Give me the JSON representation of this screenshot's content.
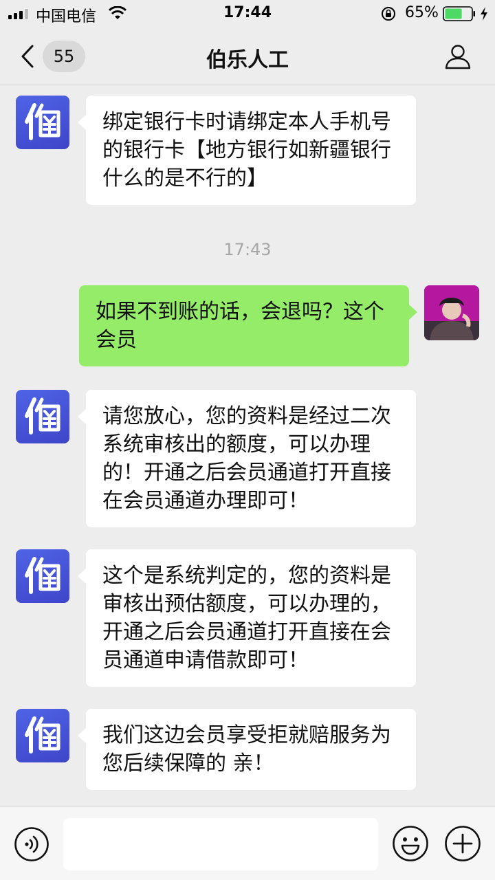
{
  "status_bar": {
    "carrier": "中国电信",
    "time": "17:44",
    "battery_percent": "65%",
    "battery_level": 0.65,
    "signal_icon": "signal-bars-icon",
    "wifi_icon": "wifi-icon",
    "lock_icon": "orientation-lock-icon",
    "charge_icon": "charging-bolt-icon"
  },
  "navbar": {
    "title": "伯乐人工",
    "unread_count": "55",
    "back_icon": "chevron-left-icon",
    "profile_icon": "person-icon"
  },
  "messages": [
    {
      "sender": "bot",
      "text": "绑定银行卡时请绑定本人手机号的银行卡【地方银行如新疆银行什么的是不行的】"
    },
    {
      "type": "timestamp",
      "text": "17:43"
    },
    {
      "sender": "me",
      "text": "如果不到账的话，会退吗？这个会员"
    },
    {
      "sender": "bot",
      "text": "请您放心，您的资料是经过二次系统审核出的额度，可以办理的！开通之后会员通道打开直接在会员通道办理即可！"
    },
    {
      "sender": "bot",
      "text": "这个是系统判定的，您的资料是审核出预估额度，可以办理的，开通之后会员通道打开直接在会员通道申请借款即可！"
    },
    {
      "sender": "bot",
      "text": "我们这边会员享受拒就赔服务为您后续保障的 亲！"
    }
  ],
  "bot_avatar": {
    "icon": "yuan-logo-icon"
  },
  "input_bar": {
    "voice_icon": "voice-icon",
    "emoji_icon": "emoji-icon",
    "plus_icon": "plus-icon",
    "placeholder": ""
  },
  "colors": {
    "background": "#ededed",
    "incoming_bubble": "#ffffff",
    "outgoing_bubble": "#95ec69",
    "bot_avatar": "#4b56dc",
    "battery_fill": "#4cd964"
  }
}
